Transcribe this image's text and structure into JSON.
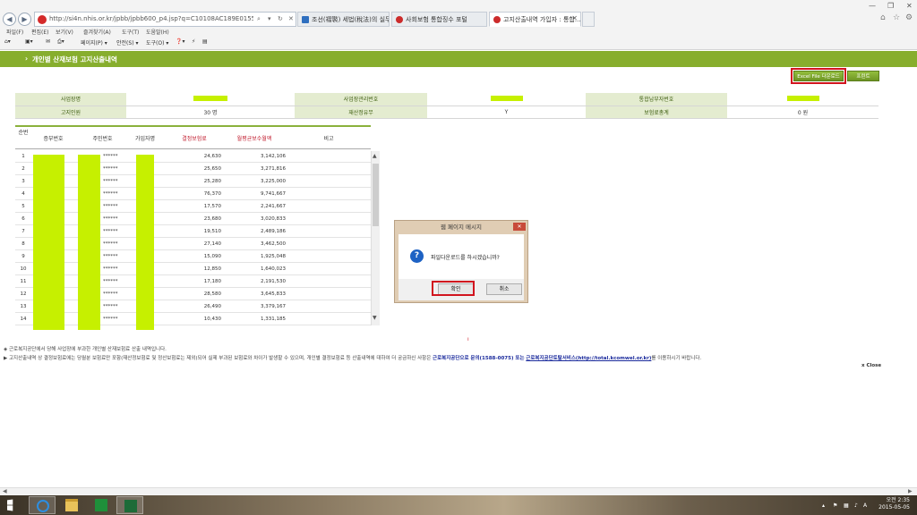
{
  "browser": {
    "url": "http://si4n.nhis.or.kr/jpbb/jpbb600_p4.jsp?q=C10108AC189E0155C5632AA58352282",
    "tabs": [
      {
        "label": "조선(褶褧) 세법(稅法)의 실무..."
      },
      {
        "label": "사회보험 통합징수 포털"
      },
      {
        "label": "고지산출내역 가입자 : 통합..."
      }
    ],
    "menu": [
      "파일(F)",
      "편집(E)",
      "보기(V)",
      "즐겨찾기(A)",
      "도구(T)",
      "도움말(H)"
    ],
    "commands": [
      "페이지(P) ▾",
      "안전(S) ▾",
      "도구(O) ▾"
    ]
  },
  "page": {
    "title": "개인별 산재보험 고지산출내역",
    "excel_button": "Excel File 다운로드",
    "print_button": "프린트"
  },
  "info": {
    "biz_name_label": "사업장명",
    "biz_mgmt_label": "사업장관리번호",
    "integ_label": "통합납부자번호",
    "count_label": "고지인원",
    "count_value": "30 명",
    "recalc_label": "재산정유무",
    "recalc_value": "Y",
    "total_label": "보험료총계",
    "total_value": "0 원"
  },
  "grid": {
    "headers": [
      "순번",
      "증부번호",
      "주민번호",
      "가입자명",
      "결정보험료",
      "월평균보수월액",
      "비고"
    ],
    "masked": "******",
    "rows": [
      {
        "no": "1",
        "premium": "24,630",
        "avg": "3,142,106"
      },
      {
        "no": "2",
        "premium": "25,650",
        "avg": "3,271,816"
      },
      {
        "no": "3",
        "premium": "25,280",
        "avg": "3,225,000"
      },
      {
        "no": "4",
        "premium": "76,370",
        "avg": "9,741,667"
      },
      {
        "no": "5",
        "premium": "17,570",
        "avg": "2,241,667"
      },
      {
        "no": "6",
        "premium": "23,680",
        "avg": "3,020,833"
      },
      {
        "no": "7",
        "premium": "19,510",
        "avg": "2,489,186"
      },
      {
        "no": "8",
        "premium": "27,140",
        "avg": "3,462,500"
      },
      {
        "no": "9",
        "premium": "15,090",
        "avg": "1,925,048"
      },
      {
        "no": "10",
        "premium": "12,850",
        "avg": "1,640,023"
      },
      {
        "no": "11",
        "premium": "17,180",
        "avg": "2,191,530"
      },
      {
        "no": "12",
        "premium": "28,580",
        "avg": "3,645,833"
      },
      {
        "no": "13",
        "premium": "26,490",
        "avg": "3,379,167"
      },
      {
        "no": "14",
        "premium": "10,430",
        "avg": "1,331,185"
      }
    ]
  },
  "notes": {
    "line1": "◈ 근로복지공단에서 당해 사업장에 부과한 개인별 산재보험료 산출 내역입니다.",
    "line2_pre": "▶ 고지산출내역 상 결정보험료에는 당월분 보험료만 포함(재산정보험료 및 정산보험료는 제외)되어 실제 부과된 보험료와 차이가 발생할 수 있으며, 개인별 결정보험료 등 산출내역에 대하여 더 궁금하신 사항은 ",
    "line2_link1": "근로복지공단으로 문의(1588-0075) 또는",
    "line2_link2": "근로복지공단토탈서비스(http://total.kcomwel.or.kr)",
    "line2_post": "를 이용하시기 바랍니다.",
    "close": "x Close"
  },
  "dialog": {
    "title": "웹 페이지 메시지",
    "message": "파일다운로드를 하시겠습니까?",
    "ok": "확인",
    "cancel": "취소"
  },
  "taskbar": {
    "time": "오전 2:35",
    "date": "2015-05-05"
  },
  "colors": {
    "header_green": "#87ae2d",
    "label_bg": "#e4ecd0",
    "mask_lime": "#c6f000",
    "highlight_red": "#d1141e"
  }
}
